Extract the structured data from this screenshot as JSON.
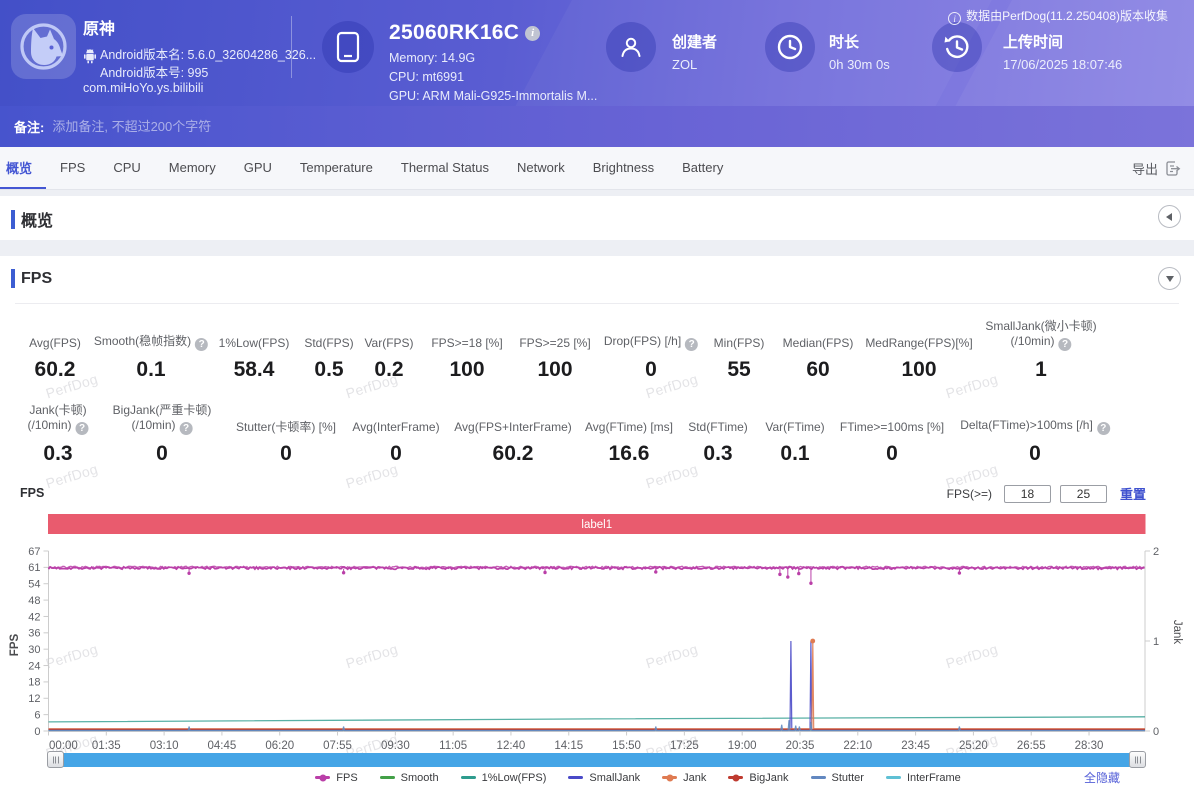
{
  "header": {
    "app": {
      "name": "原神",
      "android_version_name": "Android版本名: 5.6.0_32604286_326...",
      "android_version_code": "Android版本号: 995",
      "package": "com.miHoYo.ys.bilibili"
    },
    "device": {
      "model": "25060RK16C",
      "memory": "Memory: 14.9G",
      "cpu": "CPU: mt6991",
      "gpu": "GPU: ARM Mali-G925-Immortalis M..."
    },
    "creator": {
      "label": "创建者",
      "value": "ZOL"
    },
    "duration": {
      "label": "时长",
      "value": "0h 30m 0s"
    },
    "upload_time": {
      "label": "上传时间",
      "value": "17/06/2025 18:07:46"
    },
    "collect_notice": "数据由PerfDog(11.2.250408)版本收集"
  },
  "remark": {
    "label": "备注:",
    "placeholder": "添加备注, 不超过200个字符"
  },
  "tabs": {
    "items": [
      "概览",
      "FPS",
      "CPU",
      "Memory",
      "GPU",
      "Temperature",
      "Thermal Status",
      "Network",
      "Brightness",
      "Battery"
    ],
    "active_index": 0,
    "export_label": "导出"
  },
  "sections": {
    "overview_title": "概览",
    "fps_title": "FPS"
  },
  "fps_stats": {
    "row1": [
      {
        "label": "Avg(FPS)",
        "value": "60.2"
      },
      {
        "label": "Smooth(稳帧指数)",
        "help": true,
        "value": "0.1"
      },
      {
        "label": "1%Low(FPS)",
        "value": "58.4"
      },
      {
        "label": "Std(FPS)",
        "value": "0.5"
      },
      {
        "label": "Var(FPS)",
        "value": "0.2"
      },
      {
        "label": "FPS>=18 [%]",
        "value": "100"
      },
      {
        "label": "FPS>=25 [%]",
        "value": "100"
      },
      {
        "label": "Drop(FPS) [/h]",
        "help": true,
        "value": "0"
      },
      {
        "label": "Min(FPS)",
        "value": "55"
      },
      {
        "label": "Median(FPS)",
        "value": "60"
      },
      {
        "label": "MedRange(FPS)[%]",
        "value": "100"
      },
      {
        "label": "SmallJank(微小卡顿)\n(/10min)",
        "help": true,
        "value": "1"
      }
    ],
    "row2": [
      {
        "label": "Jank(卡顿)\n(/10min)",
        "help": true,
        "value": "0.3"
      },
      {
        "label": "BigJank(严重卡顿)\n(/10min)",
        "help": true,
        "value": "0"
      },
      {
        "label": "Stutter(卡顿率) [%]",
        "value": "0"
      },
      {
        "label": "Avg(InterFrame)",
        "value": "0"
      },
      {
        "label": "Avg(FPS+InterFrame)",
        "value": "60.2"
      },
      {
        "label": "Avg(FTime) [ms]",
        "value": "16.6"
      },
      {
        "label": "Std(FTime)",
        "value": "0.3"
      },
      {
        "label": "Var(FTime)",
        "value": "0.1"
      },
      {
        "label": "FTime>=100ms [%]",
        "value": "0"
      },
      {
        "label": "Delta(FTime)>100ms [/h]",
        "help": true,
        "value": "0"
      }
    ]
  },
  "chart_header": {
    "title": "FPS",
    "threshold_label": "FPS(>=)",
    "threshold_low": "18",
    "threshold_high": "25",
    "reset_label": "重置"
  },
  "chart_footer": {
    "hide_all": "全隐藏"
  },
  "watermark": "PerfDog",
  "chart_data": {
    "type": "line",
    "band_label": "label1",
    "band_color": "#e95b6e",
    "x": {
      "unit": "mm:ss",
      "tick_interval_s": 95,
      "range_s": [
        0,
        1802
      ],
      "tick_labels": [
        "00:00",
        "01:35",
        "03:10",
        "04:45",
        "06:20",
        "07:55",
        "09:30",
        "11:05",
        "12:40",
        "14:15",
        "15:50",
        "17:25",
        "19:00",
        "20:35",
        "22:10",
        "23:45",
        "25:20",
        "26:55",
        "28:30"
      ]
    },
    "y_left": {
      "label": "FPS",
      "max": 67,
      "tick_labels": [
        "0",
        "6",
        "12",
        "18",
        "24",
        "30",
        "36",
        "42",
        "48",
        "54",
        "61",
        "67"
      ]
    },
    "y_right": {
      "label": "Jank",
      "max": 2,
      "tick_labels": [
        "0",
        "1",
        "2"
      ]
    },
    "series": [
      {
        "name": "FPS",
        "color": "#ba3fa8",
        "axis": "left",
        "style": "noisy",
        "base": 60.35,
        "noise": 0.9,
        "dips": [
          [
            231,
            58.7
          ],
          [
            485,
            58.9
          ],
          [
            816,
            59.0
          ],
          [
            998,
            59.2
          ],
          [
            1202,
            58.3
          ],
          [
            1215,
            57.3
          ],
          [
            1233,
            58.6
          ],
          [
            1253,
            55.0
          ],
          [
            1497,
            58.8
          ]
        ]
      },
      {
        "name": "Smooth",
        "color": "#43a047",
        "axis": "left",
        "style": "trend",
        "points": [
          [
            0,
            0.3
          ],
          [
            1802,
            0.35
          ]
        ]
      },
      {
        "name": "1%Low(FPS)",
        "color": "#2e9c8e",
        "axis": "left",
        "style": "trend",
        "points": [
          [
            0,
            3.4
          ],
          [
            900,
            4.5
          ],
          [
            1802,
            5.3
          ]
        ]
      },
      {
        "name": "SmallJank",
        "color": "#4a4ac8",
        "axis": "right",
        "style": "spikes",
        "base": 0.012,
        "events": [
          [
            1220,
            1.0
          ],
          [
            1253,
            1.0
          ]
        ]
      },
      {
        "name": "Jank",
        "color": "#df7b52",
        "axis": "right",
        "style": "spikes",
        "base": 0.026,
        "cap": true,
        "events": [
          [
            1256,
            1.0
          ]
        ]
      },
      {
        "name": "BigJank",
        "color": "#bf3b30",
        "axis": "right",
        "style": "spikes",
        "base": 0.018,
        "events": []
      },
      {
        "name": "Stutter",
        "color": "#6288c0",
        "axis": "right",
        "style": "spikes",
        "base": 0.005,
        "events": [
          [
            231,
            0.05
          ],
          [
            485,
            0.05
          ],
          [
            998,
            0.05
          ],
          [
            1205,
            0.07
          ],
          [
            1217,
            0.12
          ],
          [
            1228,
            0.06
          ],
          [
            1234,
            0.05
          ],
          [
            1253,
            0.1
          ],
          [
            1497,
            0.05
          ]
        ]
      },
      {
        "name": "InterFrame",
        "color": "#5fc0d4",
        "axis": "left",
        "style": "trend",
        "points": [
          [
            0,
            0.5
          ],
          [
            1802,
            0.5
          ]
        ]
      }
    ],
    "legend_dot": [
      "FPS",
      "Jank",
      "BigJank"
    ]
  }
}
